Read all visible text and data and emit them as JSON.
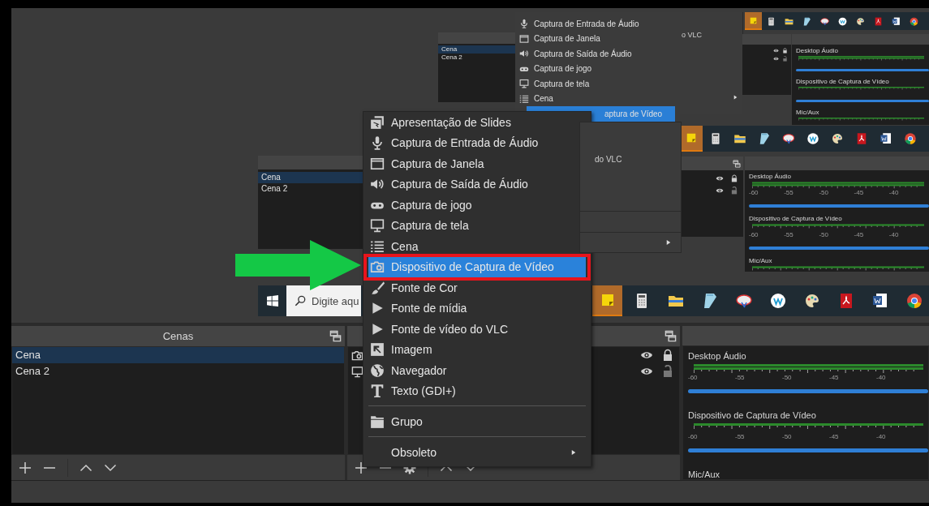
{
  "preview": {
    "mid": {
      "scenes": [
        {
          "name": "Cena",
          "selected": true
        },
        {
          "name": "Cena 2",
          "selected": false
        }
      ],
      "menu_fragment": {
        "label": "do VLC"
      },
      "sources": [
        {
          "visible": true,
          "locked": true
        },
        {
          "visible": true,
          "locked": false
        }
      ],
      "mixer": [
        {
          "name": "Desktop Áudio",
          "kind": "stereo",
          "ticks": [
            "-60",
            "-55",
            "-50",
            "-45",
            "-40"
          ],
          "level": 1
        },
        {
          "name": "Dispositivo de Captura de Vídeo",
          "kind": "mono",
          "ticks": [
            "-60",
            "-55",
            "-50",
            "-45",
            "-40"
          ],
          "level": 1
        },
        {
          "name": "Mic/Aux",
          "kind": "mono"
        }
      ],
      "search": {
        "placeholder": "Digite aqu"
      }
    },
    "inner": {
      "scenes": [
        {
          "name": "Cena",
          "selected": true
        },
        {
          "name": "Cena 2",
          "selected": false
        }
      ],
      "menu": [
        {
          "label": "Captura de Entrada de Áudio",
          "selected": false
        },
        {
          "label": "Captura de Janela",
          "selected": false
        },
        {
          "label": "Captura de Saída de Áudio",
          "selected": false
        },
        {
          "label": "Captura de jogo",
          "selected": false
        },
        {
          "label": "Captura de tela",
          "selected": false
        },
        {
          "label": "Cena",
          "selected": false
        },
        {
          "label": "aptura de Vídeo",
          "selected": true
        }
      ],
      "menu_fragment": {
        "label": "o VLC"
      },
      "sources": [
        {
          "visible": true,
          "locked": true
        },
        {
          "visible": true,
          "locked": false
        }
      ],
      "mixer": [
        {
          "name": "Desktop Áudio",
          "kind": "stereo",
          "level": 1
        },
        {
          "name": "Dispositivo de Captura de Vídeo",
          "kind": "mono",
          "level": 1
        },
        {
          "name": "Mic/Aux",
          "kind": "mono"
        }
      ]
    }
  },
  "docks": {
    "scenes": {
      "title": "Cenas",
      "items": [
        {
          "name": "Cena",
          "selected": true
        },
        {
          "name": "Cena 2",
          "selected": false
        }
      ]
    },
    "sources": {
      "items": [
        {
          "visible": true,
          "locked": true
        },
        {
          "visible": true,
          "locked": false
        }
      ]
    },
    "mixer": {
      "channels": [
        {
          "name": "Desktop Áudio",
          "kind": "stereo",
          "ticks": [
            "-60",
            "-55",
            "-50",
            "-45",
            "-40"
          ],
          "level": 1
        },
        {
          "name": "Dispositivo de Captura de Vídeo",
          "kind": "mono",
          "ticks": [
            "-60",
            "-55",
            "-50",
            "-45",
            "-40"
          ],
          "level": 1
        },
        {
          "name": "Mic/Aux",
          "kind": "mono"
        }
      ]
    }
  },
  "context_menu": {
    "groups": [
      [
        {
          "label": "Apresentação de Slides",
          "kind": "item",
          "selected": false,
          "outlined": false
        },
        {
          "label": "Captura de Entrada de Áudio",
          "kind": "item",
          "selected": false,
          "outlined": false
        },
        {
          "label": "Captura de Janela",
          "kind": "item",
          "selected": false,
          "outlined": false
        },
        {
          "label": "Captura de Saída de Áudio",
          "kind": "item",
          "selected": false,
          "outlined": false
        },
        {
          "label": "Captura de jogo",
          "kind": "item",
          "selected": false,
          "outlined": false
        },
        {
          "label": "Captura de tela",
          "kind": "item",
          "selected": false,
          "outlined": false
        },
        {
          "label": "Cena",
          "kind": "item",
          "selected": false,
          "outlined": false
        },
        {
          "label": "Dispositivo de Captura de Vídeo",
          "kind": "item",
          "selected": true,
          "outlined": true
        },
        {
          "label": "Fonte de Cor",
          "kind": "item",
          "selected": false,
          "outlined": false
        },
        {
          "label": "Fonte de mídia",
          "kind": "item",
          "selected": false,
          "outlined": false
        },
        {
          "label": "Fonte de vídeo do VLC",
          "kind": "item",
          "selected": false,
          "outlined": false
        },
        {
          "label": "Imagem",
          "kind": "item",
          "selected": false,
          "outlined": false
        },
        {
          "label": "Navegador",
          "kind": "item",
          "selected": false,
          "outlined": false
        },
        {
          "label": "Texto (GDI+)",
          "kind": "item",
          "selected": false,
          "outlined": false
        }
      ],
      [
        {
          "label": "Grupo",
          "kind": "item",
          "selected": false,
          "outlined": false
        }
      ],
      [
        {
          "label": "Obsoleto",
          "kind": "submenu",
          "selected": false,
          "outlined": false
        }
      ]
    ]
  },
  "callout_arrow": true
}
